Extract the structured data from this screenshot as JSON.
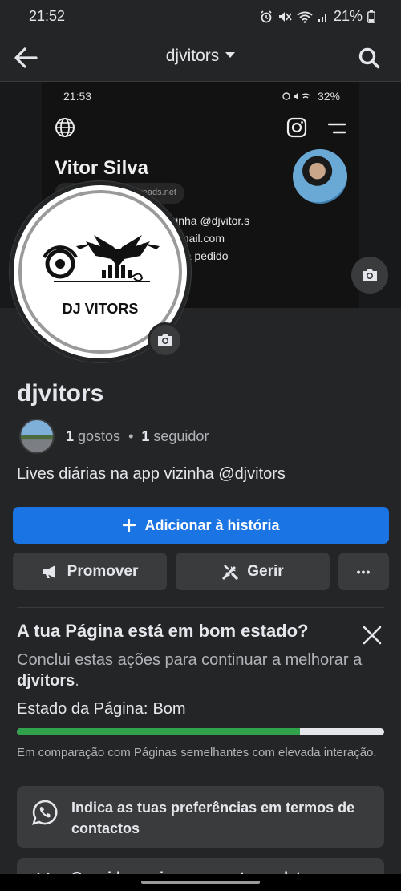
{
  "status_bar": {
    "time": "21:52",
    "battery": "21%"
  },
  "app_bar": {
    "title": "djvitors"
  },
  "cover": {
    "time": "21:53",
    "battery": "32%",
    "name": "Vitor Silva",
    "chip": "di...threads.net",
    "bio_lines": [
      "vizinha @djvitor.s",
      "@gmail.com",
      "sica a pedido"
    ]
  },
  "profile_picture": {
    "logo_text": "DJ VITORS"
  },
  "page": {
    "name": "djvitors",
    "likes_count": "1",
    "likes_label": "gostos",
    "separator": "•",
    "followers_count": "1",
    "followers_label": "seguidor",
    "bio": "Lives diárias na app vizinha @djvitors"
  },
  "actions": {
    "add_story": "Adicionar à história",
    "promote": "Promover",
    "manage": "Gerir",
    "more": "•••"
  },
  "health": {
    "title": "A tua Página está em bom estado?",
    "subtitle_prefix": "Conclui estas ações para continuar a melhorar a ",
    "subtitle_page": "djvitors",
    "subtitle_suffix": ".",
    "status_label": "Estado da Página:",
    "status_value": "Bom",
    "progress": 0.77,
    "comparison": "Em comparação com Páginas semelhantes com elevada interação."
  },
  "tasks": [
    {
      "label": "Indica as tuas preferências em termos de contactos",
      "icon": "whatsapp-icon"
    },
    {
      "label": "Considera criar um evento ou data",
      "icon": "calendar-icon"
    }
  ],
  "colors": {
    "background": "#242526",
    "primary_button": "#1b74e4",
    "secondary_button": "#3a3b3c",
    "progress_good": "#31a24c"
  }
}
